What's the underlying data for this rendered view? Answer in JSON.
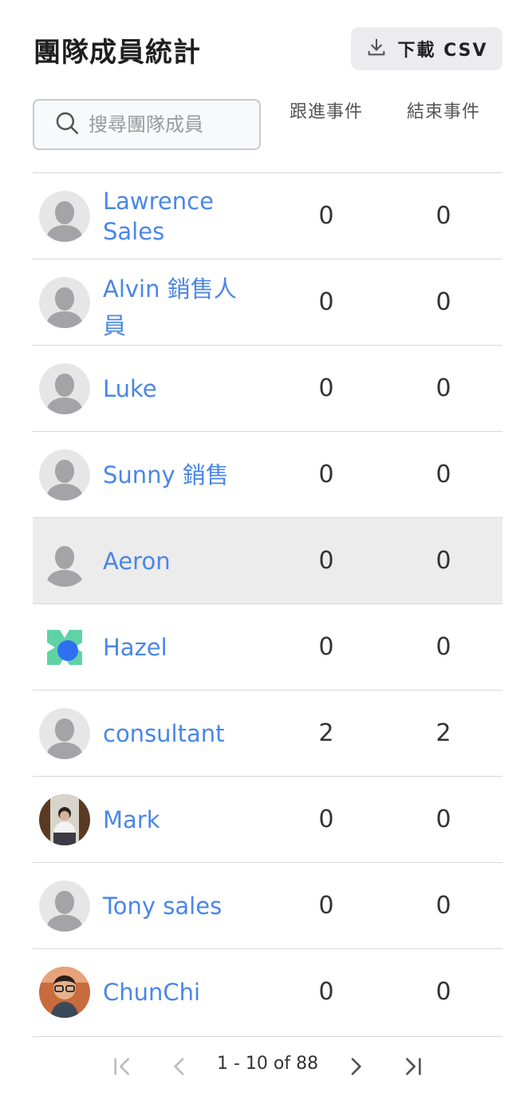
{
  "title": "團隊成員統計",
  "download_label": "下載 CSV",
  "search": {
    "placeholder": "搜尋團隊成員"
  },
  "columns": {
    "follow_up": "跟進事件",
    "closed": "結束事件"
  },
  "rows": [
    {
      "name": "Lawrence Sales",
      "follow_up": "0",
      "closed": "0",
      "avatar": "default-avatar"
    },
    {
      "name": "Alvin 銷售人員",
      "follow_up": "0",
      "closed": "0",
      "avatar": "default-avatar"
    },
    {
      "name": "Luke",
      "follow_up": "0",
      "closed": "0",
      "avatar": "default-avatar"
    },
    {
      "name": "Sunny 銷售",
      "follow_up": "0",
      "closed": "0",
      "avatar": "default-avatar"
    },
    {
      "name": "Aeron",
      "follow_up": "0",
      "closed": "0",
      "avatar": "default-avatar"
    },
    {
      "name": "Hazel",
      "follow_up": "0",
      "closed": "0",
      "avatar": "logo-avatar"
    },
    {
      "name": "consultant",
      "follow_up": "2",
      "closed": "2",
      "avatar": "default-avatar"
    },
    {
      "name": "Mark",
      "follow_up": "0",
      "closed": "0",
      "avatar": "photo-avatar"
    },
    {
      "name": "Tony sales",
      "follow_up": "0",
      "closed": "0",
      "avatar": "default-avatar"
    },
    {
      "name": "ChunChi",
      "follow_up": "0",
      "closed": "0",
      "avatar": "photo-avatar"
    }
  ],
  "pagination": {
    "range": "1 - 10 of 88"
  },
  "colors": {
    "link": "#4a86e8",
    "highlight_row": "#ececec",
    "button_bg": "#ececee"
  }
}
